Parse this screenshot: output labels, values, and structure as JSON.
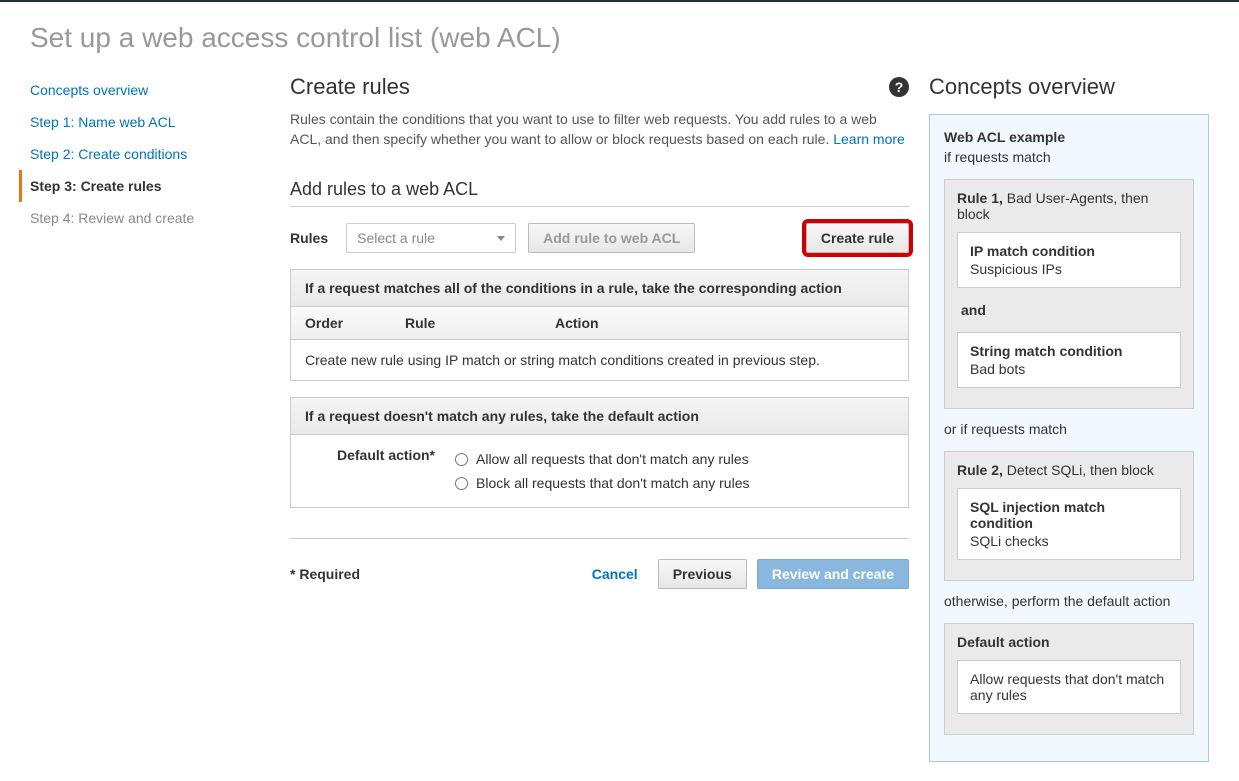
{
  "page_title": "Set up a web access control list (web ACL)",
  "sidebar": {
    "items": [
      {
        "label": "Concepts overview",
        "active": false,
        "disabled": false
      },
      {
        "label": "Step 1: Name web ACL",
        "active": false,
        "disabled": false
      },
      {
        "label": "Step 2: Create conditions",
        "active": false,
        "disabled": false
      },
      {
        "label": "Step 3: Create rules",
        "active": true,
        "disabled": false
      },
      {
        "label": "Step 4: Review and create",
        "active": false,
        "disabled": true
      }
    ]
  },
  "main": {
    "title": "Create rules",
    "help_glyph": "?",
    "description_text": "Rules contain the conditions that you want to use to filter web requests. You add rules to a web ACL, and then specify whether you want to allow or block requests based on each rule. ",
    "learn_more": "Learn more",
    "section_title": "Add rules to a web ACL",
    "rules_label": "Rules",
    "select_placeholder": "Select a rule",
    "add_rule_button": "Add rule to web ACL",
    "create_rule_button": "Create rule",
    "match_panel": {
      "header": "If a request matches all of the conditions in a rule, take the corresponding action",
      "col_order": "Order",
      "col_rule": "Rule",
      "col_action": "Action",
      "body": "Create new rule using IP match or string match conditions created in previous step."
    },
    "default_panel": {
      "header": "If a request doesn't match any rules, take the default action",
      "label": "Default action*",
      "opt_allow": "Allow all requests that don't match any rules",
      "opt_block": "Block all requests that don't match any rules"
    },
    "footer": {
      "required_note": "* Required",
      "cancel": "Cancel",
      "previous": "Previous",
      "review": "Review and create"
    }
  },
  "concepts": {
    "title": "Concepts overview",
    "example_title": "Web ACL example",
    "if_match": "if requests match",
    "rule1_head_bold": "Rule 1,",
    "rule1_head_rest": " Bad User-Agents, then block",
    "cond1_title": "IP match condition",
    "cond1_body": "Suspicious IPs",
    "and": "and",
    "cond2_title": "String match condition",
    "cond2_body": "Bad bots",
    "or_if_match": "or if requests match",
    "rule2_head_bold": "Rule 2,",
    "rule2_head_rest": " Detect SQLi, then block",
    "cond3_title": "SQL injection match condition",
    "cond3_body": "SQLi checks",
    "otherwise": "otherwise, perform the default action",
    "default_title": "Default action",
    "default_body": "Allow requests that don't match any rules"
  }
}
